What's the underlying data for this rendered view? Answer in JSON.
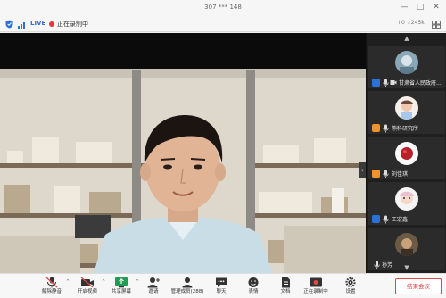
{
  "window": {
    "title": "307 *** 148",
    "minimize": "—",
    "maximize": "□",
    "close": "✕"
  },
  "status": {
    "live": "LIVE",
    "recording": "正在录制中",
    "network": "↑0  ↓245k"
  },
  "participants": [
    {
      "name": "甘肃省人民政府..."
    },
    {
      "name": "熊科研究所"
    },
    {
      "name": "刘佳琪"
    },
    {
      "name": "王宏鑫"
    },
    {
      "name": "孙芳"
    }
  ],
  "toolbar": {
    "mute_label": "解除静音",
    "video_label": "开启视频",
    "share_label": "共享屏幕",
    "invite_label": "邀请",
    "members_label": "管理成员(288)",
    "chat_label": "聊天",
    "reactions_label": "表情",
    "docs_label": "文档",
    "record_label": "正在录制中",
    "settings_label": "设置",
    "end_label": "结束会议"
  },
  "colors": {
    "accent": "#2b72d8",
    "danger": "#e04848",
    "panel_bg": "#1f1f1f",
    "toolbar_bg": "#f7f7f7"
  }
}
